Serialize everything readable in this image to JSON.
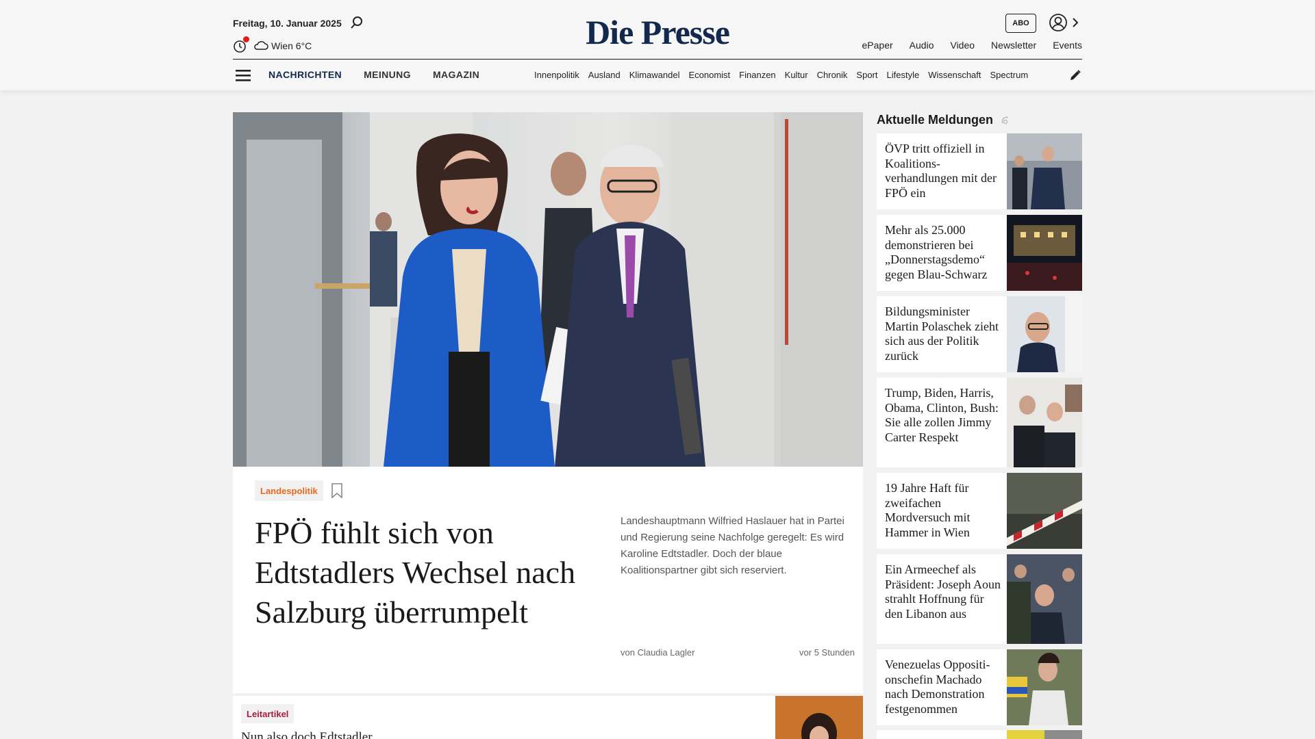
{
  "header": {
    "date": "Freitag, 10. Januar 2025",
    "weather": "Wien 6°C",
    "logo": "Die Presse",
    "abo": "ABO",
    "topnav": [
      "ePaper",
      "Audio",
      "Video",
      "Newsletter",
      "Events"
    ],
    "mainnav": [
      "NACHRICHTEN",
      "MEINUNG",
      "MAGAZIN"
    ],
    "subnav": [
      "Innenpolitik",
      "Ausland",
      "Klimawandel",
      "Economist",
      "Finanzen",
      "Kultur",
      "Chronik",
      "Sport",
      "Lifestyle",
      "Wissenschaft",
      "Spectrum"
    ]
  },
  "hero": {
    "tag": "Landespolitik",
    "title": "FPÖ fühlt sich von Edtstadlers Wechsel nach Salzburg überrumpelt",
    "lead": "Landeshauptmann Wilfried Haslauer hat in Partei und Regierung seine Nachfolge geregelt: Es wird Karoline Edtstadler. Doch der blaue Koalitionspartner gibt sich reserviert.",
    "author": "von Claudia Lagler",
    "time": "vor 5 Stunden"
  },
  "second": {
    "tag": "Leitartikel",
    "title": "Nun also doch Edtstadler"
  },
  "sidebar": {
    "title": "Aktuelle Meldungen",
    "items": [
      {
        "title": " ÖVP tritt offiziell in Koalitions-verhandlungen mit der FPÖ ein"
      },
      {
        "title": "Mehr als 25.000 demonstrieren bei „Donnerstagsdemo“ gegen Blau-Schwarz"
      },
      {
        "title": "Bildungsminister Martin Polaschek zieht sich aus der Politik zurück"
      },
      {
        "title": "Trump, Biden, Harris, Obama, Clinton, Bush: Sie alle zollen Jimmy Carter Respekt"
      },
      {
        "title": "19 Jahre Haft für zweifachen Mordversuch mit Hammer in Wien"
      },
      {
        "title": "Ein Armeechef als Präsident: Joseph Aoun strahlt Hoffnung für den Libanon aus"
      },
      {
        "title": "Venezuelas Oppositi-onschefin Machado nach Demonstration festgenommen"
      }
    ]
  },
  "colors": {
    "brand": "#12284c",
    "tag_orange": "#e8671c",
    "tag_red": "#a81c3b",
    "alert": "#d9221c"
  }
}
